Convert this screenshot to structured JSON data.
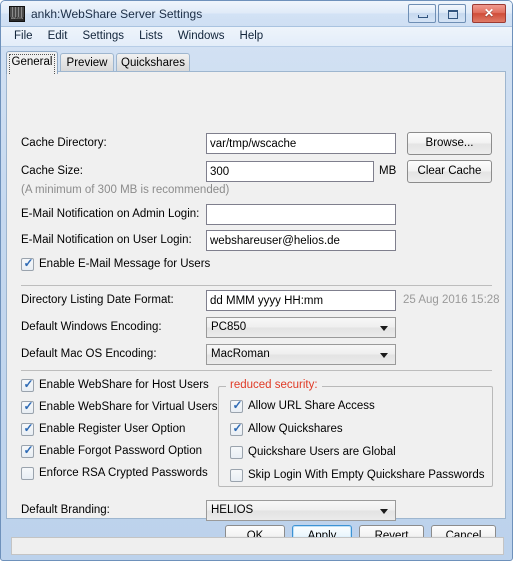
{
  "window": {
    "title": "ankh:WebShare Server Settings",
    "icon_brand": "HELIOS",
    "controls": {
      "minimize": "minimize-icon",
      "maximize": "maximize-icon",
      "close": "✕"
    }
  },
  "menubar": {
    "items": [
      {
        "label": "File"
      },
      {
        "label": "Edit"
      },
      {
        "label": "Settings"
      },
      {
        "label": "Lists"
      },
      {
        "label": "Windows"
      },
      {
        "label": "Help"
      }
    ]
  },
  "tabs": [
    {
      "label": "General",
      "selected": true
    },
    {
      "label": "Preview",
      "selected": false
    },
    {
      "label": "Quickshares",
      "selected": false
    }
  ],
  "general": {
    "cache_directory": {
      "label": "Cache Directory:",
      "value": "var/tmp/wscache",
      "placeholder": "",
      "browse_label": "Browse..."
    },
    "cache_size": {
      "label": "Cache Size:",
      "value": "300",
      "placeholder": "",
      "unit": "MB",
      "clear_label": "Clear Cache",
      "hint": "(A minimum of 300 MB is recommended)"
    },
    "email_admin": {
      "label": "E-Mail Notification on Admin Login:",
      "value": "",
      "placeholder": ""
    },
    "email_user": {
      "label": "E-Mail Notification on User Login:",
      "value": "webshareuser@helios.de",
      "placeholder": ""
    },
    "enable_email_message": {
      "label": "Enable E-Mail Message for Users",
      "checked": true,
      "mark": "✓"
    },
    "date_format": {
      "label": "Directory Listing Date Format:",
      "value": "dd MMM yyyy HH:mm",
      "placeholder": "",
      "preview": "25 Aug 2016 15:28"
    },
    "windows_encoding": {
      "label": "Default Windows Encoding:",
      "value": "PC850"
    },
    "mac_encoding": {
      "label": "Default Mac OS Encoding:",
      "value": "MacRoman"
    },
    "left_options": [
      {
        "label": "Enable WebShare for Host Users",
        "checked": true,
        "mark": "✓"
      },
      {
        "label": "Enable WebShare for Virtual Users",
        "checked": true,
        "mark": "✓"
      },
      {
        "label": "Enable Register User Option",
        "checked": true,
        "mark": "✓"
      },
      {
        "label": "Enable Forgot Password Option",
        "checked": true,
        "mark": "✓"
      },
      {
        "label": "Enforce RSA Crypted Passwords",
        "checked": false,
        "mark": ""
      }
    ],
    "reduced_security": {
      "title": "reduced security:",
      "title_color": "#e03a26",
      "options": [
        {
          "label": "Allow URL Share Access",
          "checked": true,
          "mark": "✓"
        },
        {
          "label": "Allow Quickshares",
          "checked": true,
          "mark": "✓"
        },
        {
          "label": "Quickshare Users are Global",
          "checked": false,
          "mark": ""
        },
        {
          "label": "Skip Login With Empty Quickshare Passwords",
          "checked": false,
          "mark": ""
        }
      ]
    },
    "branding": {
      "label": "Default Branding:",
      "value": "HELIOS"
    }
  },
  "buttons": {
    "ok": "OK",
    "apply": "Apply",
    "revert": "Revert",
    "cancel": "Cancel",
    "default_button": "Apply"
  },
  "statusbar": {
    "text": ""
  }
}
